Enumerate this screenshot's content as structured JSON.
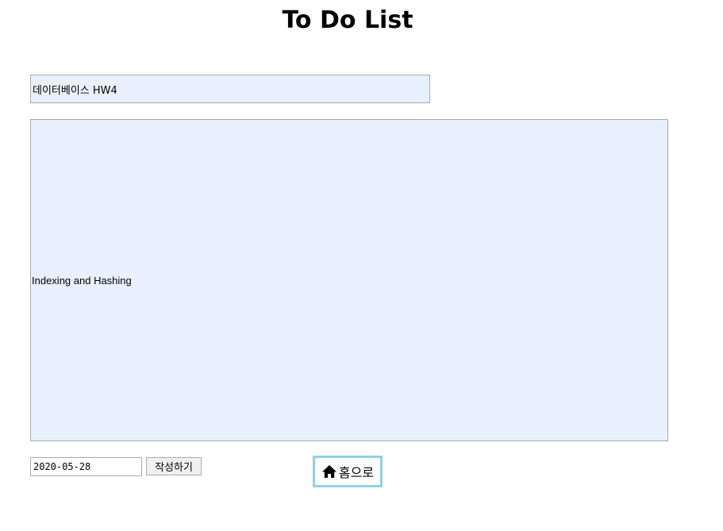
{
  "header": {
    "title": "To Do List"
  },
  "form": {
    "title_value": "데이터베이스 HW4",
    "content_value": "Indexing and Hashing",
    "date_value": "2020-05-28",
    "submit_label": "작성하기"
  },
  "nav": {
    "home_label": "홈으로",
    "home_icon": "home-icon",
    "home_border_color": "#8fd0e6"
  },
  "colors": {
    "field_background": "#e8f0fe"
  }
}
